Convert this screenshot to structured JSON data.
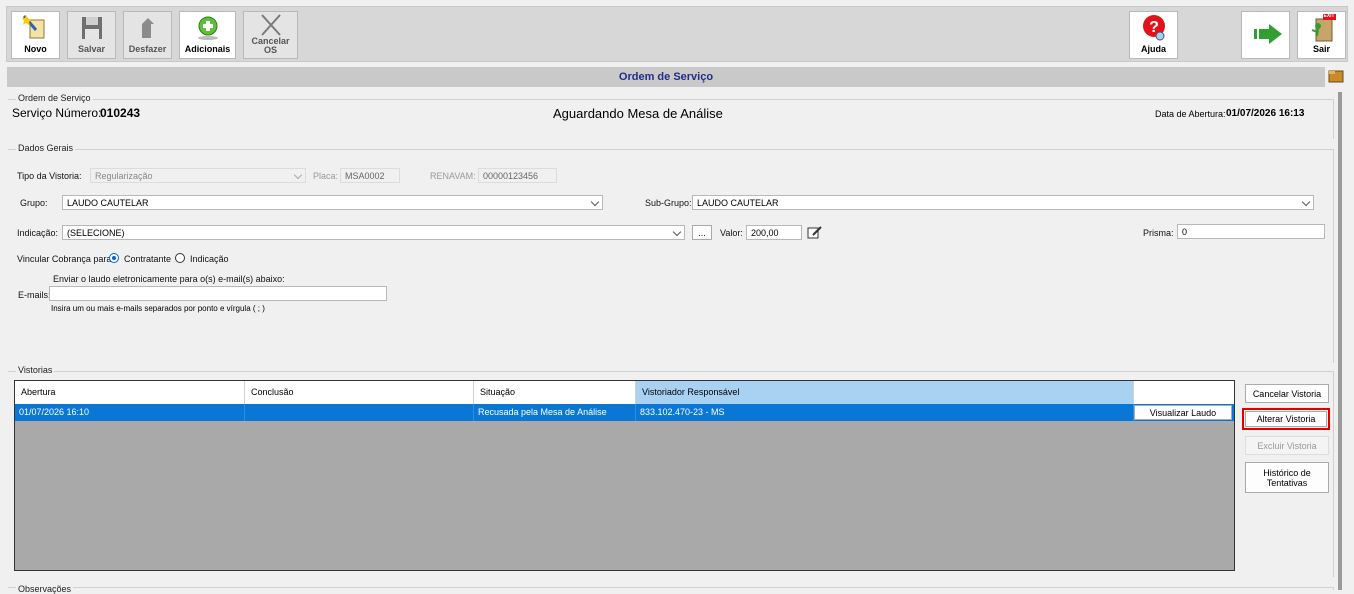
{
  "toolbar": {
    "novo": "Novo",
    "salvar": "Salvar",
    "desfazer": "Desfazer",
    "adicionais": "Adicionais",
    "cancelar_os_1": "Cancelar",
    "cancelar_os_2": "OS",
    "ajuda": "Ajuda",
    "sair": "Sair",
    "exit_sign": "EXIT"
  },
  "title": "Ordem de Serviço",
  "ordem": {
    "group_title": "Ordem de Serviço",
    "numero_label": "Serviço Número:",
    "numero": "010243",
    "status": "Aguardando Mesa de Análise",
    "abertura_label": "Data de Abertura:",
    "abertura": "01/07/2026 16:13"
  },
  "dados": {
    "group_title": "Dados Gerais",
    "tipo_label": "Tipo da Vistoria:",
    "tipo_value": "Regularização",
    "placa_label": "Placa:",
    "placa_value": "MSA0002",
    "renavam_label": "RENAVAM:",
    "renavam_value": "00000123456",
    "grupo_label": "Grupo:",
    "grupo_value": "LAUDO CAUTELAR",
    "subgrupo_label": "Sub-Grupo:",
    "subgrupo_value": "LAUDO CAUTELAR",
    "indicacao_label": "Indicação:",
    "indicacao_value": "(SELECIONE)",
    "ellipsis": "...",
    "valor_label": "Valor:",
    "valor_value": "200,00",
    "prisma_label": "Prisma:",
    "prisma_value": "0",
    "vincular_label": "Vincular Cobrança para:",
    "opt_contratante": "Contratante",
    "opt_indicacao": "Indicação",
    "enviar_text": "Enviar o laudo eletronicamente para o(s) e-mail(s) abaixo:",
    "emails_label": "E-mails:",
    "emails_value": "",
    "emails_hint": "Insira um ou mais e-mails separados por ponto e vírgula ( ; )"
  },
  "vistorias": {
    "group_title": "Vistorias",
    "columns": [
      "Abertura",
      "Conclusão",
      "Situação",
      "Vistoriador Responsável"
    ],
    "rows": [
      {
        "abertura": "01/07/2026 16:10",
        "conclusao": "",
        "situacao": "Recusada pela Mesa de Análise",
        "vistoriador": "833.102.470-23 - MS",
        "action": "Visualizar Laudo"
      }
    ],
    "btn_cancelar": "Cancelar Vistoria",
    "btn_alterar": "Alterar Vistoria",
    "btn_excluir": "Excluir Vistoria",
    "btn_historico_1": "Histórico de",
    "btn_historico_2": "Tentativas"
  },
  "observacoes": {
    "group_title": "Observações"
  },
  "colors": {
    "highlight_border": "#e00000",
    "row_selected": "#0a77d6",
    "header_selected": "#a9d1f2",
    "title_text": "#1f2e8a"
  }
}
